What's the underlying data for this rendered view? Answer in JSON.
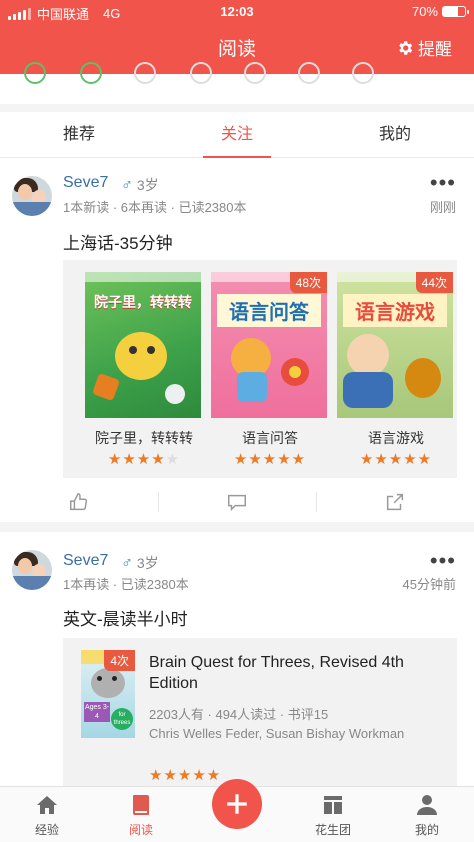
{
  "status_bar": {
    "carrier": "中国联通",
    "network": "4G",
    "time": "12:03",
    "battery_percent": "70%",
    "battery_level": 0.7
  },
  "header": {
    "title": "阅读",
    "remind_label": "提醒"
  },
  "tabs": [
    {
      "label": "推荐",
      "active": false
    },
    {
      "label": "关注",
      "active": true
    },
    {
      "label": "我的",
      "active": false
    }
  ],
  "posts": [
    {
      "user_name": "Seve7",
      "gender_symbol": "♂",
      "age": "3岁",
      "stats": "1本新读 · 6本再读 · 已读2380本",
      "time": "刚刚",
      "title": "上海话-35分钟",
      "books": [
        {
          "title": "院子里，转转转",
          "cover_text": "院子里，转转转",
          "badge": "",
          "rating": 4
        },
        {
          "title": "语言问答",
          "cover_text": "语言问答",
          "badge": "48次",
          "rating": 5
        },
        {
          "title": "语言游戏",
          "cover_text": "语言游戏",
          "badge": "44次",
          "rating": 5
        }
      ]
    },
    {
      "user_name": "Seve7",
      "gender_symbol": "♂",
      "age": "3岁",
      "stats": "1本再读 · 已读2380本",
      "time": "45分钟前",
      "title": "英文-晨读半小时",
      "book": {
        "badge": "4次",
        "title": "Brain Quest for Threes, Revised 4th Edition",
        "meta": "2203人有 · 494人读过 · 书评15",
        "author": "Chris Welles Feder, Susan Bishay Workman",
        "cover_label_1": "Ages 3-4",
        "cover_label_2": "for threes",
        "rating": 5
      }
    }
  ],
  "bottom_nav": [
    {
      "label": "经验",
      "icon": "home-icon"
    },
    {
      "label": "阅读",
      "icon": "book-icon",
      "active": true
    },
    {
      "label": "",
      "icon": "plus-icon"
    },
    {
      "label": "花生团",
      "icon": "group-icon"
    },
    {
      "label": "我的",
      "icon": "person-icon"
    }
  ],
  "colors": {
    "brand_red": "#f0544a",
    "star_orange": "#ee7a23",
    "link_blue": "#3a6ea5"
  }
}
